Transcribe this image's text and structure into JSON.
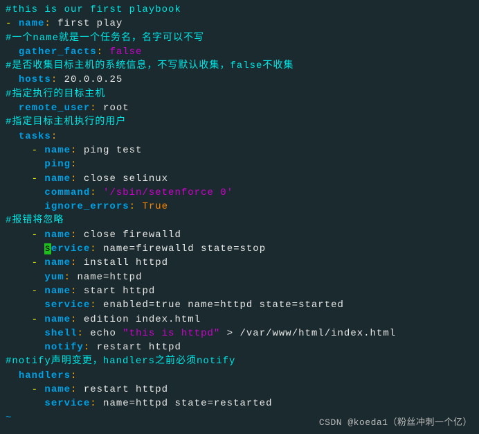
{
  "lines": [
    {
      "segs": [
        {
          "cls": "comment",
          "t": "#this is our first playbook"
        }
      ]
    },
    {
      "segs": [
        {
          "cls": "dash",
          "t": "- "
        },
        {
          "cls": "key",
          "t": "name"
        },
        {
          "cls": "colon",
          "t": ": "
        },
        {
          "cls": "white",
          "t": "first play"
        }
      ]
    },
    {
      "segs": [
        {
          "cls": "comment",
          "t": "#一个name就是一个任务名，名字可以不写"
        }
      ]
    },
    {
      "segs": [
        {
          "cls": "white",
          "t": "  "
        },
        {
          "cls": "key",
          "t": "gather_facts"
        },
        {
          "cls": "colon",
          "t": ": "
        },
        {
          "cls": "magenta",
          "t": "false"
        }
      ]
    },
    {
      "segs": [
        {
          "cls": "comment",
          "t": "#是否收集目标主机的系统信息，不写默认收集，false不收集"
        }
      ]
    },
    {
      "segs": [
        {
          "cls": "white",
          "t": "  "
        },
        {
          "cls": "key",
          "t": "hosts"
        },
        {
          "cls": "colon",
          "t": ": "
        },
        {
          "cls": "white",
          "t": "20.0.0.25"
        }
      ]
    },
    {
      "segs": [
        {
          "cls": "comment",
          "t": "#指定执行的目标主机"
        }
      ]
    },
    {
      "segs": [
        {
          "cls": "white",
          "t": "  "
        },
        {
          "cls": "key",
          "t": "remote_user"
        },
        {
          "cls": "colon",
          "t": ": "
        },
        {
          "cls": "white",
          "t": "root"
        }
      ]
    },
    {
      "segs": [
        {
          "cls": "comment",
          "t": "#指定目标主机执行的用户"
        }
      ]
    },
    {
      "segs": [
        {
          "cls": "white",
          "t": "  "
        },
        {
          "cls": "key",
          "t": "tasks"
        },
        {
          "cls": "colon",
          "t": ":"
        }
      ]
    },
    {
      "segs": [
        {
          "cls": "white",
          "t": "    "
        },
        {
          "cls": "dash",
          "t": "- "
        },
        {
          "cls": "key",
          "t": "name"
        },
        {
          "cls": "colon",
          "t": ": "
        },
        {
          "cls": "white",
          "t": "ping test"
        }
      ]
    },
    {
      "segs": [
        {
          "cls": "white",
          "t": "      "
        },
        {
          "cls": "key",
          "t": "ping"
        },
        {
          "cls": "colon",
          "t": ":"
        }
      ]
    },
    {
      "segs": [
        {
          "cls": "white",
          "t": "    "
        },
        {
          "cls": "dash",
          "t": "- "
        },
        {
          "cls": "key",
          "t": "name"
        },
        {
          "cls": "colon",
          "t": ": "
        },
        {
          "cls": "white",
          "t": "close selinux"
        }
      ]
    },
    {
      "segs": [
        {
          "cls": "white",
          "t": "      "
        },
        {
          "cls": "key",
          "t": "command"
        },
        {
          "cls": "colon",
          "t": ": "
        },
        {
          "cls": "string",
          "t": "'/sbin/setenforce 0'"
        }
      ]
    },
    {
      "segs": [
        {
          "cls": "white",
          "t": "      "
        },
        {
          "cls": "key",
          "t": "ignore_errors"
        },
        {
          "cls": "colon",
          "t": ": "
        },
        {
          "cls": "orange",
          "t": "True"
        }
      ]
    },
    {
      "segs": [
        {
          "cls": "comment",
          "t": "#报错将忽略"
        }
      ]
    },
    {
      "segs": [
        {
          "cls": "white",
          "t": "    "
        },
        {
          "cls": "dash",
          "t": "- "
        },
        {
          "cls": "key",
          "t": "name"
        },
        {
          "cls": "colon",
          "t": ": "
        },
        {
          "cls": "white",
          "t": "close firewalld"
        }
      ]
    },
    {
      "segs": [
        {
          "cls": "white",
          "t": "      "
        },
        {
          "cls": "cursor",
          "t": "s"
        },
        {
          "cls": "key",
          "t": "ervice"
        },
        {
          "cls": "colon",
          "t": ": "
        },
        {
          "cls": "white",
          "t": "name=firewalld state=stop"
        }
      ]
    },
    {
      "segs": [
        {
          "cls": "white",
          "t": "    "
        },
        {
          "cls": "dash",
          "t": "- "
        },
        {
          "cls": "key",
          "t": "name"
        },
        {
          "cls": "colon",
          "t": ": "
        },
        {
          "cls": "white",
          "t": "install httpd"
        }
      ]
    },
    {
      "segs": [
        {
          "cls": "white",
          "t": "      "
        },
        {
          "cls": "key",
          "t": "yum"
        },
        {
          "cls": "colon",
          "t": ": "
        },
        {
          "cls": "white",
          "t": "name=httpd"
        }
      ]
    },
    {
      "segs": [
        {
          "cls": "white",
          "t": "    "
        },
        {
          "cls": "dash",
          "t": "- "
        },
        {
          "cls": "key",
          "t": "name"
        },
        {
          "cls": "colon",
          "t": ": "
        },
        {
          "cls": "white",
          "t": "start httpd"
        }
      ]
    },
    {
      "segs": [
        {
          "cls": "white",
          "t": "      "
        },
        {
          "cls": "key",
          "t": "service"
        },
        {
          "cls": "colon",
          "t": ": "
        },
        {
          "cls": "white",
          "t": "enabled=true name=httpd state=started"
        }
      ]
    },
    {
      "segs": [
        {
          "cls": "white",
          "t": "    "
        },
        {
          "cls": "dash",
          "t": "- "
        },
        {
          "cls": "key",
          "t": "name"
        },
        {
          "cls": "colon",
          "t": ": "
        },
        {
          "cls": "white",
          "t": "edition index.html"
        }
      ]
    },
    {
      "segs": [
        {
          "cls": "white",
          "t": "      "
        },
        {
          "cls": "key",
          "t": "shell"
        },
        {
          "cls": "colon",
          "t": ": "
        },
        {
          "cls": "white",
          "t": "echo "
        },
        {
          "cls": "string",
          "t": "\"this is httpd\""
        },
        {
          "cls": "white",
          "t": " > /var/www/html/index.html"
        }
      ]
    },
    {
      "segs": [
        {
          "cls": "white",
          "t": "      "
        },
        {
          "cls": "key",
          "t": "notify"
        },
        {
          "cls": "colon",
          "t": ": "
        },
        {
          "cls": "white",
          "t": "restart httpd"
        }
      ]
    },
    {
      "segs": [
        {
          "cls": "comment",
          "t": "#notify声明变更，handlers之前必须notify"
        }
      ]
    },
    {
      "segs": [
        {
          "cls": "white",
          "t": "  "
        },
        {
          "cls": "key",
          "t": "handlers"
        },
        {
          "cls": "colon",
          "t": ":"
        }
      ]
    },
    {
      "segs": [
        {
          "cls": "white",
          "t": "    "
        },
        {
          "cls": "dash",
          "t": "- "
        },
        {
          "cls": "key",
          "t": "name"
        },
        {
          "cls": "colon",
          "t": ": "
        },
        {
          "cls": "white",
          "t": "restart httpd"
        }
      ]
    },
    {
      "segs": [
        {
          "cls": "white",
          "t": "      "
        },
        {
          "cls": "key",
          "t": "service"
        },
        {
          "cls": "colon",
          "t": ": "
        },
        {
          "cls": "white",
          "t": "name=httpd state=restarted"
        }
      ]
    },
    {
      "segs": [
        {
          "cls": "tilde",
          "t": "~"
        }
      ]
    }
  ],
  "watermark": "CSDN @koeda1（粉丝冲刺一个亿）"
}
